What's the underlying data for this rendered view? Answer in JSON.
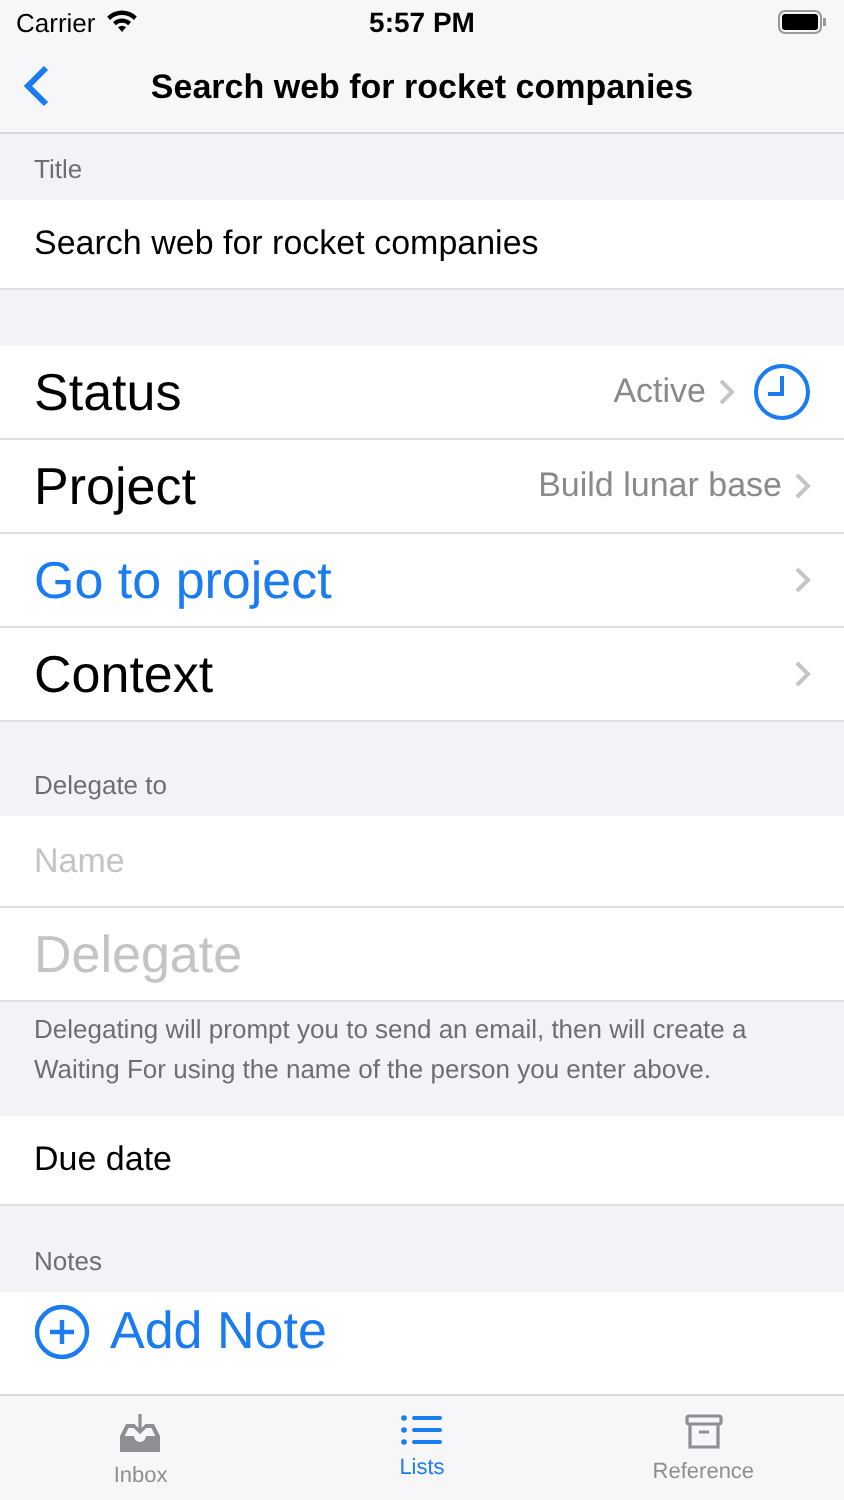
{
  "status_bar": {
    "carrier": "Carrier",
    "time": "5:57 PM"
  },
  "nav_bar": {
    "title": "Search web for rocket companies"
  },
  "title_section": {
    "header": "Title",
    "value": "Search web for rocket companies"
  },
  "detail_rows": [
    {
      "kind": "status",
      "label": "Status",
      "value": "Active"
    },
    {
      "kind": "value",
      "label": "Project",
      "value": "Build lunar base"
    },
    {
      "kind": "link",
      "label": "Go to project"
    },
    {
      "kind": "plain",
      "label": "Context"
    }
  ],
  "delegate_section": {
    "header": "Delegate to",
    "name_placeholder": "Name",
    "button": "Delegate",
    "footer": "Delegating will prompt you to send an email, then will create a Waiting For using the name of the person you enter above."
  },
  "due_date": {
    "label": "Due date"
  },
  "notes_section": {
    "header": "Notes",
    "add_label": "Add Note"
  },
  "tabs": [
    {
      "label": "Inbox",
      "kind": "inbox",
      "selected": false
    },
    {
      "label": "Lists",
      "kind": "list",
      "selected": true
    },
    {
      "label": "Reference",
      "kind": "archive",
      "selected": false
    }
  ]
}
